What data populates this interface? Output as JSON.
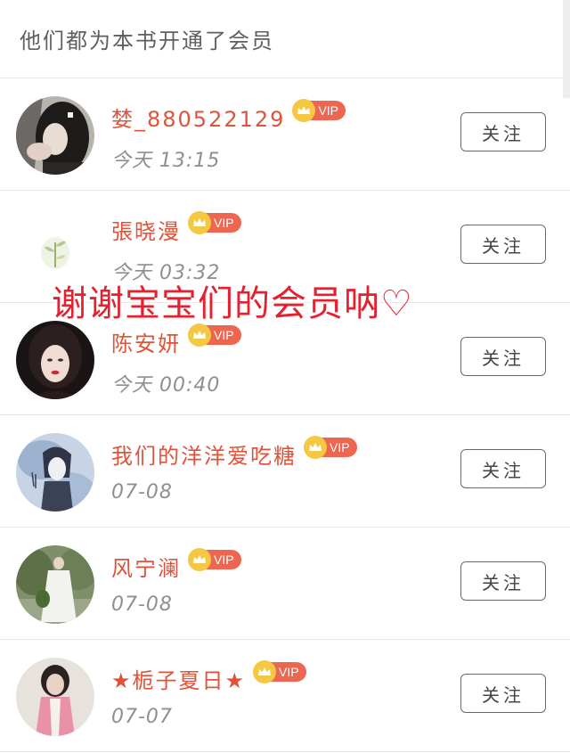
{
  "header": {
    "title": "他们都为本书开通了会员"
  },
  "overlay": {
    "caption": "谢谢宝宝们的会员呐♡"
  },
  "members": [
    {
      "name": "婪_880522129",
      "badge": "VIP",
      "time": "今天 13:15",
      "follow_label": "关注",
      "avatar_icon": "woman-portrait-dark-hair"
    },
    {
      "name": "張晓漫",
      "badge": "VIP",
      "time": "今天 03:32",
      "follow_label": "关注",
      "avatar_icon": "green-plant-sketch"
    },
    {
      "name": "陈安妍",
      "badge": "VIP",
      "time": "今天 00:40",
      "follow_label": "关注",
      "avatar_icon": "woman-portrait-red-lips"
    },
    {
      "name": "我们的洋洋爱吃糖",
      "badge": "VIP",
      "time": "07-08",
      "follow_label": "关注",
      "avatar_icon": "anime-boy-illustration"
    },
    {
      "name": "风宁澜",
      "badge": "VIP",
      "time": "07-08",
      "follow_label": "关注",
      "avatar_icon": "woman-white-dress-garden"
    },
    {
      "name": "★栀子夏日★",
      "badge": "VIP",
      "time": "07-07",
      "follow_label": "关注",
      "avatar_icon": "woman-pink-jacket"
    }
  ],
  "colors": {
    "name": "#e0533a",
    "vip_badge": "#ee6650",
    "crown": "#f4c842",
    "caption": "#e5202f"
  }
}
